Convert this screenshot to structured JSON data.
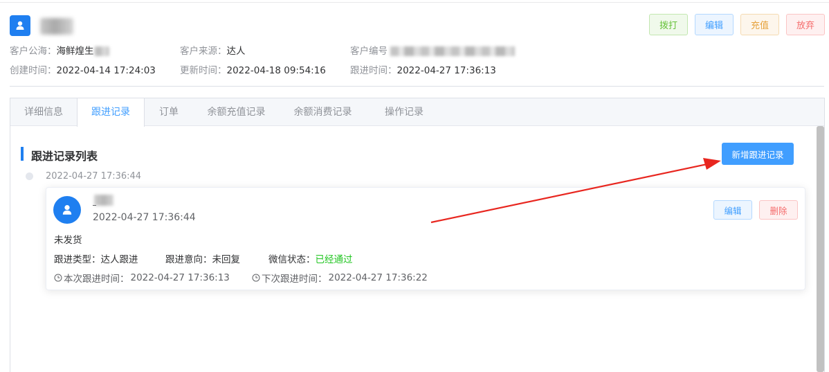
{
  "header": {
    "buttons": {
      "call": "拨打",
      "edit": "编辑",
      "recharge": "充值",
      "abandon": "放弃"
    },
    "fields": {
      "pool_label": "客户公海：",
      "pool_value": "海鲜煌生",
      "source_label": "客户来源：",
      "source_value": "达人",
      "id_label": "客户编号",
      "created_label": "创建时间：",
      "created_value": "2022-04-14 17:24:03",
      "updated_label": "更新时间：",
      "updated_value": "2022-04-18 09:54:16",
      "followed_label": "跟进时间：",
      "followed_value": "2022-04-27 17:36:13"
    }
  },
  "tabs": [
    "详细信息",
    "跟进记录",
    "订单",
    "余额充值记录",
    "余额消费记录",
    "操作记录"
  ],
  "active_tab": "跟进记录",
  "section": {
    "title": "跟进记录列表",
    "add_button": "新增跟进记录"
  },
  "timeline": [
    {
      "time": "2022-04-27 17:36:44",
      "record": {
        "time": "2022-04-27 17:36:44",
        "edit": "编辑",
        "delete": "删除",
        "content": "未发货",
        "type_label": "跟进类型：",
        "type_value": "达人跟进",
        "intent_label": "跟进意向：",
        "intent_value": "未回复",
        "wechat_label": "微信状态：",
        "wechat_value": "已经通过",
        "this_time_label": "本次跟进时间：",
        "this_time_value": "2022-04-27 17:36:13",
        "next_time_label": "下次跟进时间：",
        "next_time_value": "2022-04-27 17:36:22"
      }
    }
  ],
  "colors": {
    "primary": "#409eff",
    "brand_blue": "#1f7ff0",
    "success": "#1ec41e",
    "annotation_arrow": "#e8261f"
  },
  "icons": [
    "user-icon",
    "clock-icon"
  ]
}
